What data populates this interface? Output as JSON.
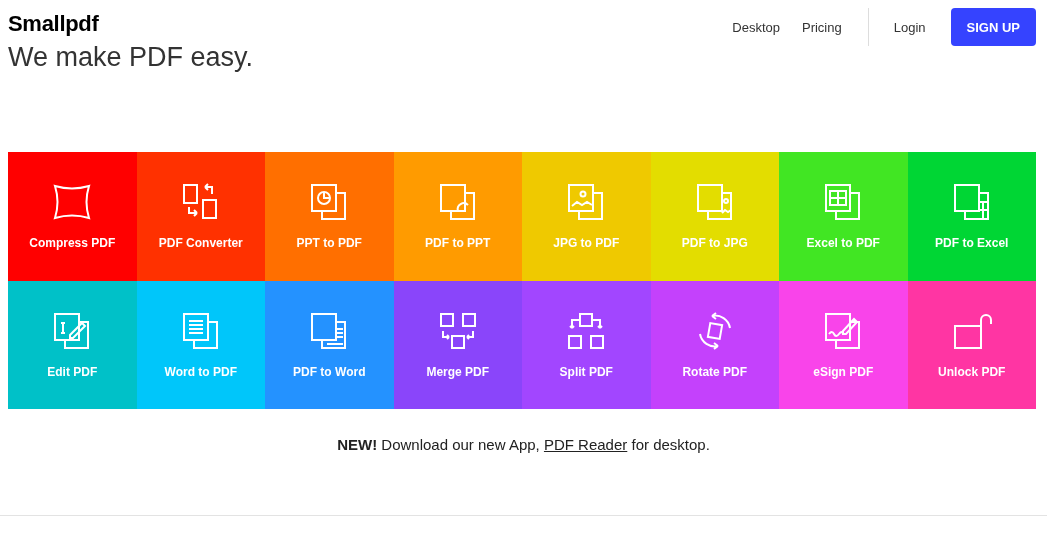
{
  "header": {
    "logo": "Smallpdf",
    "tagline": "We make PDF easy.",
    "nav": [
      "Desktop",
      "Pricing"
    ],
    "login": "Login",
    "signup": "SIGN UP"
  },
  "tools": [
    {
      "label": "Compress PDF",
      "kind": "compress",
      "color": "#ff0000"
    },
    {
      "label": "PDF Converter",
      "kind": "convert",
      "color": "#ff3100"
    },
    {
      "label": "PPT to PDF",
      "kind": "ppt",
      "color": "#ff6f00"
    },
    {
      "label": "PDF to PPT",
      "kind": "pdfppt",
      "color": "#ff9b00"
    },
    {
      "label": "JPG to PDF",
      "kind": "jpg",
      "color": "#efc900"
    },
    {
      "label": "PDF to JPG",
      "kind": "pdfjpg",
      "color": "#e3dd00"
    },
    {
      "label": "Excel to PDF",
      "kind": "excel",
      "color": "#41e623"
    },
    {
      "label": "PDF to Excel",
      "kind": "pdfexcel",
      "color": "#00d634"
    },
    {
      "label": "Edit PDF",
      "kind": "edit",
      "color": "#00c1c8"
    },
    {
      "label": "Word to PDF",
      "kind": "word",
      "color": "#00c6fa"
    },
    {
      "label": "PDF to Word",
      "kind": "pdfword",
      "color": "#2492ff"
    },
    {
      "label": "Merge PDF",
      "kind": "merge",
      "color": "#8a45fa"
    },
    {
      "label": "Split PDF",
      "kind": "split",
      "color": "#a246ff"
    },
    {
      "label": "Rotate PDF",
      "kind": "rotate",
      "color": "#c441fc"
    },
    {
      "label": "eSign PDF",
      "kind": "esign",
      "color": "#f944ea"
    },
    {
      "label": "Unlock PDF",
      "kind": "unlock",
      "color": "#ff35a3"
    }
  ],
  "notice": {
    "text": "**NEW!** Download our new App, ",
    "link": "PDF Reader",
    "text_after": " for desktop."
  }
}
